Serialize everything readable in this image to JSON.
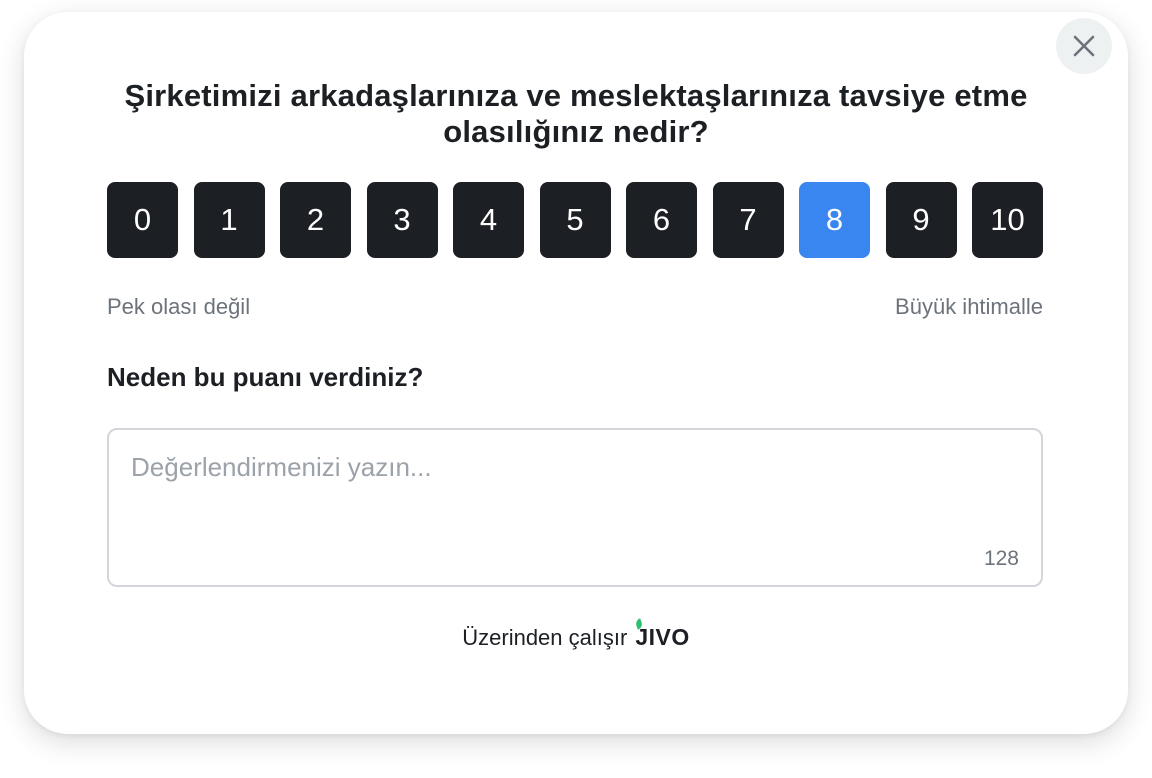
{
  "survey": {
    "title": "Şirketimizi arkadaşlarınıza ve meslektaşlarınıza tavsiye etme olasılığınız nedir?",
    "scores": [
      "0",
      "1",
      "2",
      "3",
      "4",
      "5",
      "6",
      "7",
      "8",
      "9",
      "10"
    ],
    "selected_score": "8",
    "low_label": "Pek olası değil",
    "high_label": "Büyük ihtimalle",
    "question": "Neden bu puanı verdiniz?",
    "comment": {
      "value": "",
      "placeholder": "Değerlendirmenizi yazın...",
      "remaining_chars": "128"
    },
    "footer": {
      "powered_by": "Üzerinden çalışır",
      "brand": "JIVO"
    }
  },
  "colors": {
    "button_bg": "#1c1f23",
    "selected_bg": "#3a86f0",
    "close_bg": "#eef1f2",
    "muted_text": "#6c737b",
    "brand_leaf": "#2fbf71"
  },
  "icons": {
    "close": "close-icon",
    "brand": "jivo-logo-icon"
  }
}
